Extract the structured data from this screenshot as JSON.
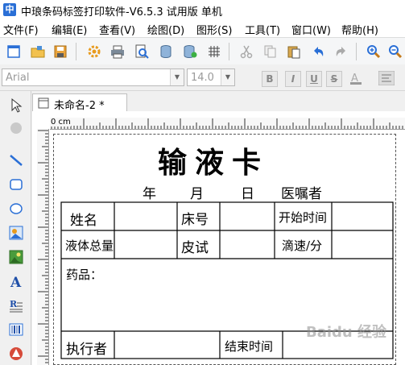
{
  "window": {
    "title": "中琅条码标签打印软件-V6.5.3 试用版 单机"
  },
  "menu": [
    "文件(F)",
    "编辑(E)",
    "查看(V)",
    "绘图(D)",
    "图形(S)",
    "工具(T)",
    "窗口(W)",
    "帮助(H)"
  ],
  "toolbar_icons": [
    "new-file-icon",
    "open-folder-icon",
    "save-icon",
    "settings-gear-icon",
    "print-icon",
    "print-preview-icon",
    "database-icon",
    "database-settings-icon",
    "grid-icon",
    "cut-icon",
    "copy-icon",
    "paste-icon",
    "undo-icon",
    "redo-icon",
    "zoom-in-icon",
    "zoom-out-icon"
  ],
  "format": {
    "font": "Arial",
    "size": "14.0",
    "bold": "B",
    "italic": "I",
    "underline": "U",
    "strike": "S"
  },
  "left_tools": [
    "select-arrow-icon",
    "pan-icon",
    "line-tool-icon",
    "rounded-rect-tool-icon",
    "ellipse-tool-icon",
    "image-tool-icon",
    "picture-tool-icon",
    "text-tool-icon",
    "rich-text-tool-icon",
    "barcode-tool-icon",
    "qrcode-tool-icon"
  ],
  "tab": {
    "label": "未命名-2 *"
  },
  "ruler": {
    "unit": "0 cm"
  },
  "card": {
    "title": "输液卡",
    "date_row": [
      "年",
      "月",
      "日",
      "医嘱者"
    ],
    "table": {
      "r1": [
        "姓名",
        "床号",
        "开始时间"
      ],
      "r2": [
        "液体总量",
        "皮试",
        "滴速/分"
      ],
      "r3": "药品：",
      "r4": [
        "执行者",
        "结束时间"
      ]
    }
  },
  "watermark": "Baidu 经验"
}
